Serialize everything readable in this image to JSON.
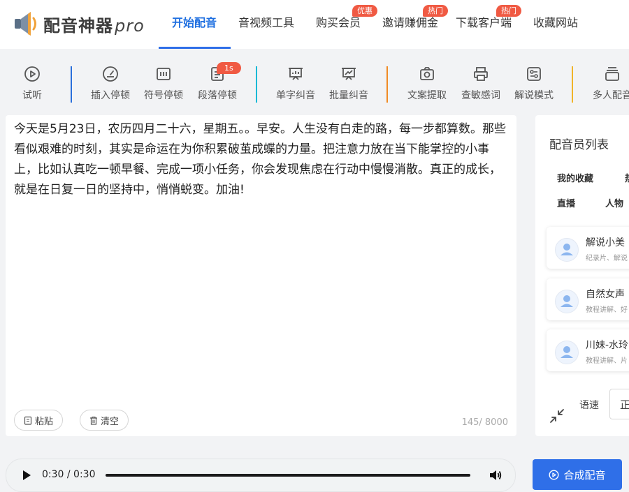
{
  "brand": {
    "name": "配音神器",
    "suffix": "pro",
    "icon": "speaker-logo-icon"
  },
  "nav": {
    "items": [
      {
        "label": "开始配音",
        "active": true
      },
      {
        "label": "音视频工具"
      },
      {
        "label": "购买会员",
        "badge": "优惠"
      },
      {
        "label": "邀请赚佣金",
        "badge": "热门"
      },
      {
        "label": "下载客户端",
        "badge": "热门"
      },
      {
        "label": "收藏网站"
      }
    ]
  },
  "toolbar": {
    "items": [
      {
        "label": "试听",
        "icon": "play-circle-icon"
      },
      {
        "label": "插入停顿",
        "icon": "gauge-icon"
      },
      {
        "label": "符号停顿",
        "icon": "pause-symbol-icon"
      },
      {
        "label": "段落停顿",
        "icon": "document-icon",
        "badge": "1s"
      },
      {
        "label": "单字纠音",
        "icon": "presentation-icon"
      },
      {
        "label": "批量纠音",
        "icon": "chart-board-icon"
      },
      {
        "label": "文案提取",
        "icon": "camera-icon"
      },
      {
        "label": "查敏感词",
        "icon": "printer-icon"
      },
      {
        "label": "解说模式",
        "icon": "settings-panel-icon"
      },
      {
        "label": "多人配音",
        "icon": "stack-icon"
      }
    ],
    "separator_colors": [
      "#2a6fdb",
      "#19b9d6",
      "#f08a24",
      "#f0b429"
    ]
  },
  "editor": {
    "text": "今天是5月23日，农历四月二十六，星期五。。早安。人生没有白走的路，每一步都算数。那些看似艰难的时刻，其实是命运在为你积累破茧成蝶的力量。把注意力放在当下能掌控的小事上，比如认真吃一顿早餐、完成一项小任务，你会发现焦虑在行动中慢慢消散。真正的成长，就是在日复一日的坚持中，悄悄蜕变。加油!",
    "paste_label": "粘贴",
    "clear_label": "清空",
    "counter": "145/ 8000"
  },
  "voice_panel": {
    "title": "配音员列表",
    "tabs": [
      "我的收藏",
      "热",
      "直播",
      "人物"
    ],
    "voices": [
      {
        "name": "解说小美",
        "desc": "纪录片、解说"
      },
      {
        "name": "自然女声",
        "desc": "教程讲解、好"
      },
      {
        "name": "川妹-水玲",
        "desc": "教程讲解、片"
      }
    ],
    "speed_label": "语速",
    "speed_value": "正"
  },
  "player": {
    "time": "0:30 / 0:30",
    "progress": 1.0
  },
  "synthesize_label": "合成配音",
  "colors": {
    "accent": "#2f6fe8",
    "badge": "#f05a43"
  }
}
